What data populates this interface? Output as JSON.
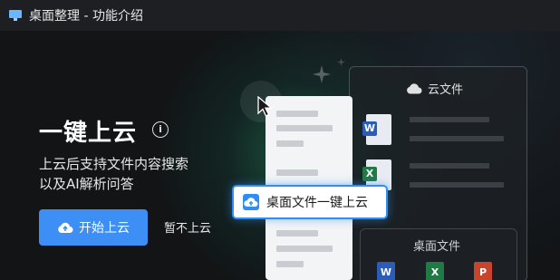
{
  "window": {
    "title": "桌面整理 - 功能介绍"
  },
  "hero": {
    "title": "一键上云",
    "info_icon": "info-icon",
    "description_line1": "上云后支持文件内容搜索",
    "description_line2": "以及AI解析问答",
    "primary_button": "开始上云",
    "secondary_button": "暂不上云"
  },
  "illustration": {
    "cloud_panel_title": "云文件",
    "desktop_panel_title": "桌面文件",
    "tooltip_label": "桌面文件一键上云",
    "file_types": [
      "word",
      "excel",
      "word",
      "excel",
      "powerpoint"
    ]
  },
  "colors": {
    "accent": "#3d8ff5",
    "background": "#121416",
    "titlebar": "#1d1f22"
  }
}
